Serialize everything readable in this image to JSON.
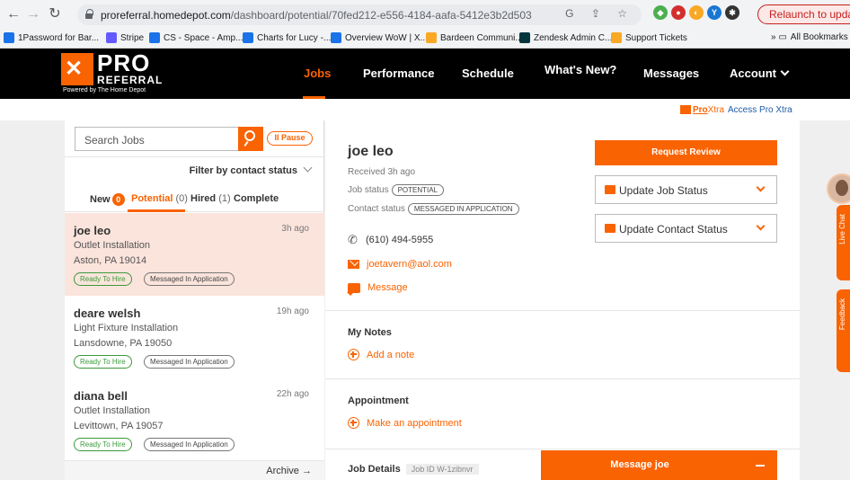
{
  "browser": {
    "url_host": "proreferral.homedepot.com",
    "url_path": "/dashboard/potential/70fed212-e556-4184-aafa-5412e3b2d503",
    "relaunch_label": "Relaunch to update",
    "bookmarks": [
      {
        "label": "1Password for Bar...",
        "color": "#1a73e8"
      },
      {
        "label": "Stripe",
        "color": "#635bff"
      },
      {
        "label": "CS - Space - Amp...",
        "color": "#1a73e8"
      },
      {
        "label": "Charts for Lucy -...",
        "color": "#1a73e8"
      },
      {
        "label": "Overview WoW | X...",
        "color": "#1a73e8"
      },
      {
        "label": "Bardeen Communi...",
        "color": "#f9a825"
      },
      {
        "label": "Zendesk Admin C...",
        "color": "#03363d"
      },
      {
        "label": "Support Tickets",
        "color": "#f9a825"
      }
    ],
    "all_bookmarks": "All Bookmarks"
  },
  "header": {
    "logo_pro": "PRO",
    "logo_referral": "REFERRAL",
    "logo_powered": "Powered by The Home Depot",
    "nav": {
      "jobs": "Jobs",
      "performance": "Performance",
      "schedule": "Schedule",
      "whats_new": "What's New?",
      "messages": "Messages",
      "account": "Account"
    },
    "accent": "#f96302"
  },
  "subbar": {
    "pro": "Pro",
    "xtra": "Xtra",
    "access_link": "Access Pro Xtra"
  },
  "left": {
    "search_placeholder": "Search Jobs",
    "pause_label": "II  Pause",
    "filter_label": "Filter by contact status",
    "tabs": {
      "new": "New",
      "new_count": "0",
      "potential": "Potential",
      "potential_count": "(0)",
      "hired": "Hired",
      "hired_count": "(1)",
      "complete": "Complete"
    },
    "jobs": [
      {
        "name": "joe leo",
        "ago": "3h ago",
        "service": "Outlet Installation",
        "location": "Aston, PA 19014",
        "tag1": "Ready To Hire",
        "tag2": "Messaged In Application"
      },
      {
        "name": "deare welsh",
        "ago": "19h ago",
        "service": "Light Fixture Installation",
        "location": "Lansdowne, PA 19050",
        "tag1": "Ready To Hire",
        "tag2": "Messaged In Application"
      },
      {
        "name": "diana bell",
        "ago": "22h ago",
        "service": "Outlet Installation",
        "location": "Levittown, PA 19057",
        "tag1": "Ready To Hire",
        "tag2": "Messaged In Application"
      }
    ],
    "archive_label": "Archive →"
  },
  "detail": {
    "name": "joe leo",
    "received": "Received 3h ago",
    "job_status_label": "Job status",
    "job_status_value": "POTENTIAL",
    "contact_status_label": "Contact status",
    "contact_status_value": "MESSAGED IN APPLICATION",
    "phone": "(610) 494-5955",
    "email": "joetavern@aol.com",
    "message_link": "Message",
    "notes_title": "My Notes",
    "add_note": "Add a note",
    "appointment_title": "Appointment",
    "make_appointment": "Make an appointment",
    "job_details_title": "Job Details",
    "job_id": "Job ID W-1zibnvr",
    "request_review": "Request Review",
    "update_job_status": "Update Job Status",
    "update_contact_status": "Update Contact Status",
    "message_bar": "Message joe"
  },
  "side": {
    "live_chat": "Live Chat",
    "feedback": "Feedback"
  }
}
